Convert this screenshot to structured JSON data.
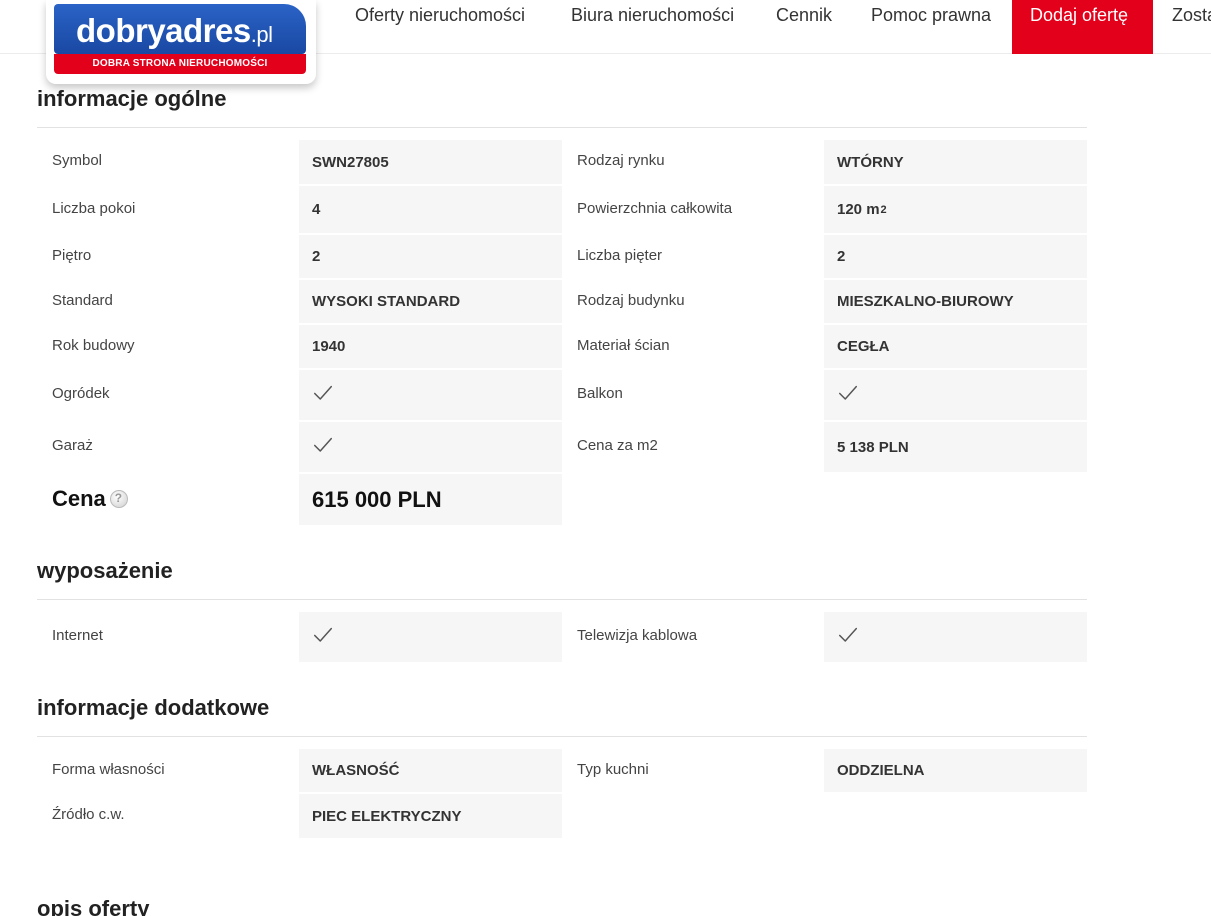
{
  "brand": {
    "name": "dobryadres",
    "tld": ".pl",
    "tagline": "DOBRA STRONA NIERUCHOMOŚCI"
  },
  "nav": {
    "items": [
      {
        "label": "Oferty nieruchomości"
      },
      {
        "label": "Biura nieruchomości"
      },
      {
        "label": "Cennik"
      },
      {
        "label": "Pomoc prawna"
      },
      {
        "label": "Dodaj ofertę"
      },
      {
        "label": "Zosta"
      }
    ]
  },
  "colors": {
    "accent": "#e3001b",
    "brand_blue": "#1a48a3",
    "cell_bg": "#f6f6f6"
  },
  "general": {
    "title": "informacje ogólne",
    "rows": [
      {
        "l1": "Symbol",
        "v1": "SWN27805",
        "l2": "Rodzaj rynku",
        "v2": "WTÓRNY"
      },
      {
        "l1": "Liczba pokoi",
        "v1": "4",
        "l2": "Powierzchnia całkowita",
        "v2": "120 m",
        "v2_sup": "2"
      },
      {
        "l1": "Piętro",
        "v1": "2",
        "l2": "Liczba pięter",
        "v2": "2"
      },
      {
        "l1": "Standard",
        "v1": "WYSOKI STANDARD",
        "l2": "Rodzaj budynku",
        "v2": "MIESZKALNO-BIUROWY"
      },
      {
        "l1": "Rok budowy",
        "v1": "1940",
        "l2": "Materiał ścian",
        "v2": "CEGŁA"
      },
      {
        "l1": "Ogródek",
        "v1_icon": "checkmark-icon",
        "l2": "Balkon",
        "v2_icon": "checkmark-icon"
      },
      {
        "l1": "Garaż",
        "v1_icon": "checkmark-icon",
        "l2": "Cena za m2",
        "v2": "5 138 PLN"
      }
    ],
    "price_label": "Cena",
    "price_value": "615 000 PLN"
  },
  "equipment": {
    "title": "wyposażenie",
    "rows": [
      {
        "l1": "Internet",
        "v1_icon": "checkmark-icon",
        "l2": "Telewizja kablowa",
        "v2_icon": "checkmark-icon"
      }
    ]
  },
  "additional": {
    "title": "informacje dodatkowe",
    "rows": [
      {
        "l1": "Forma własności",
        "v1": "WŁASNOŚĆ",
        "l2": "Typ kuchni",
        "v2": "ODDZIELNA"
      },
      {
        "l1": "Źródło c.w.",
        "v1": "PIEC ELEKTRYCZNY"
      }
    ]
  },
  "description": {
    "title": "opis oferty"
  }
}
